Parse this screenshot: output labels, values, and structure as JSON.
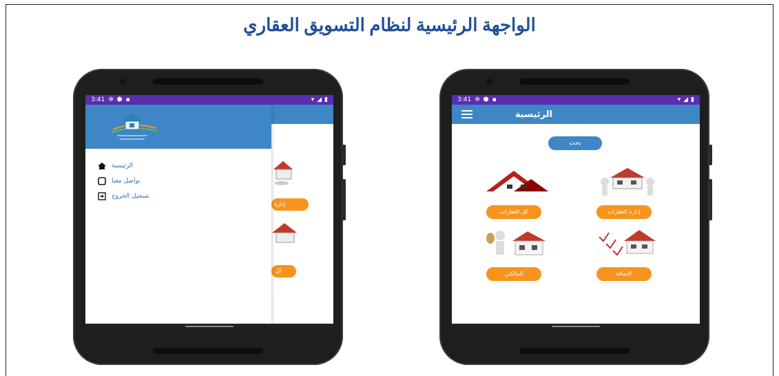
{
  "document": {
    "title": "الواجهة الرئيسية لنظام التسويق العقاري"
  },
  "phone_left": {
    "status_time": "3:41",
    "drawer_items": [
      {
        "label": "الرئيسية",
        "icon": "home-icon"
      },
      {
        "label": "تواصل معنا",
        "icon": "phone-icon"
      },
      {
        "label": "تسجيل الخروج",
        "icon": "logout-icon"
      }
    ],
    "peek_labels": [
      "إدارة",
      "ال"
    ]
  },
  "phone_right": {
    "status_time": "3:41",
    "appbar_title": "الرئيسية",
    "search_label": "بحث",
    "tiles": [
      {
        "label": "كل العقارات",
        "image": "houses-roof-icon"
      },
      {
        "label": "إدارة العقارات",
        "image": "house-carry-icon"
      },
      {
        "label": "المالكين",
        "image": "owner-money-house-icon"
      },
      {
        "label": "الإضافة",
        "image": "checklist-house-icon"
      }
    ]
  },
  "colors": {
    "statusbar": "#5a2eae",
    "appbar": "#3e86c6",
    "button_orange": "#f7941d",
    "title_blue": "#1f4e99"
  }
}
